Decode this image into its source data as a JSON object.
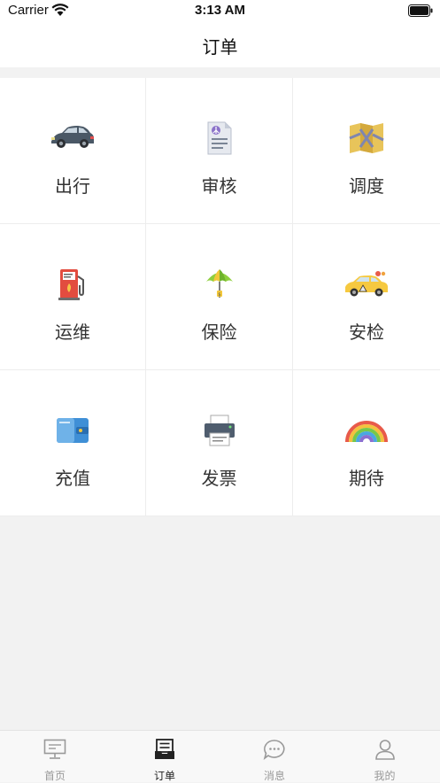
{
  "status_bar": {
    "carrier": "Carrier",
    "time": "3:13 AM"
  },
  "nav": {
    "title": "订单"
  },
  "grid": [
    {
      "label": "出行",
      "icon": "car-icon"
    },
    {
      "label": "审核",
      "icon": "document-icon"
    },
    {
      "label": "调度",
      "icon": "map-icon"
    },
    {
      "label": "运维",
      "icon": "fuel-pump-icon"
    },
    {
      "label": "保险",
      "icon": "umbrella-icon"
    },
    {
      "label": "安检",
      "icon": "taxi-icon"
    },
    {
      "label": "充值",
      "icon": "wallet-icon"
    },
    {
      "label": "发票",
      "icon": "printer-icon"
    },
    {
      "label": "期待",
      "icon": "rainbow-icon"
    }
  ],
  "tabs": [
    {
      "label": "首页",
      "icon": "monitor-icon",
      "active": false
    },
    {
      "label": "订单",
      "icon": "order-list-icon",
      "active": true
    },
    {
      "label": "消息",
      "icon": "chat-bubble-icon",
      "active": false
    },
    {
      "label": "我的",
      "icon": "person-icon",
      "active": false
    }
  ],
  "colors": {
    "background": "#f2f2f2",
    "active_tab": "#222222",
    "inactive_tab": "#999999"
  }
}
